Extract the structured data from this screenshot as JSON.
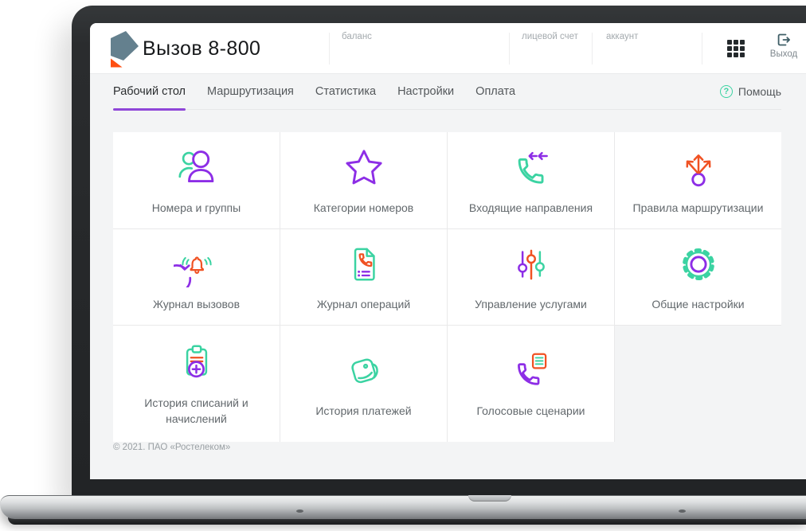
{
  "header": {
    "brand": {
      "title": "Вызов 8-800"
    },
    "fields": [
      {
        "label": "баланс"
      },
      {
        "label": "лицевой счет"
      },
      {
        "label": "аккаунт"
      }
    ],
    "apps_icon": "grid-apps-icon",
    "logout": {
      "label": "Выход",
      "icon": "logout-icon"
    }
  },
  "nav": {
    "tabs": [
      {
        "label": "Рабочий стол",
        "active": true
      },
      {
        "label": "Маршрутизация",
        "active": false
      },
      {
        "label": "Статистика",
        "active": false
      },
      {
        "label": "Настройки",
        "active": false
      },
      {
        "label": "Оплата",
        "active": false
      }
    ],
    "help": {
      "label": "Помощь",
      "icon_char": "?"
    }
  },
  "tiles": [
    {
      "label": "Номера и группы",
      "icon": "users-icon"
    },
    {
      "label": "Категории номеров",
      "icon": "star-icon"
    },
    {
      "label": "Входящие направления",
      "icon": "incoming-call-icon"
    },
    {
      "label": "Правила маршрутизации",
      "icon": "routing-arrows-icon"
    },
    {
      "label": "Журнал вызовов",
      "icon": "call-log-icon"
    },
    {
      "label": "Журнал операций",
      "icon": "operations-log-icon"
    },
    {
      "label": "Управление услугами",
      "icon": "sliders-icon"
    },
    {
      "label": "Общие настройки",
      "icon": "gear-icon"
    },
    {
      "label": "История списаний и начислений",
      "icon": "clipboard-plus-icon"
    },
    {
      "label": "История платежей",
      "icon": "wallet-icon"
    },
    {
      "label": "Голосовые сценарии",
      "icon": "voice-script-icon"
    }
  ],
  "footer": {
    "copyright": "© 2021. ПАО «Ростелеком»"
  },
  "colors": {
    "accent_purple": "#8d2ee6",
    "accent_green": "#3bd3a2",
    "accent_orange": "#f05223",
    "tab_underline": "#8f46d8",
    "logo_slate": "#64808e",
    "logo_orange": "#ff4f12"
  }
}
